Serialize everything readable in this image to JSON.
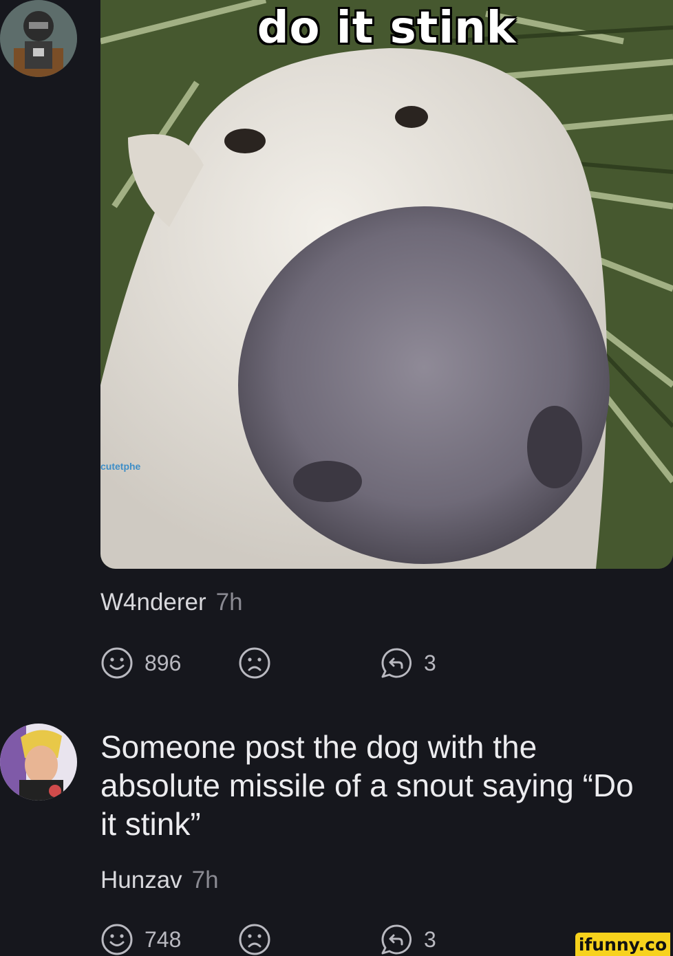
{
  "post": {
    "meme_caption": "do it stink",
    "meme_watermark": "cutetphe",
    "username": "W4nderer",
    "time": "7h",
    "smile_count": "896",
    "reply_count": "3"
  },
  "comment": {
    "text": "Someone post the dog with the absolute missile of a snout saying “Do it stink”",
    "username": "Hunzav",
    "time": "7h",
    "smile_count": "748",
    "reply_count": "3"
  },
  "icons": {
    "smile": "smile-icon",
    "frown": "frown-icon",
    "reply": "reply-icon"
  },
  "watermark": {
    "text": "ifunny.co",
    "bg": "#f7d21c"
  },
  "colors": {
    "background": "#16171d",
    "text": "#e6e6ea",
    "muted": "#8a8a92"
  }
}
